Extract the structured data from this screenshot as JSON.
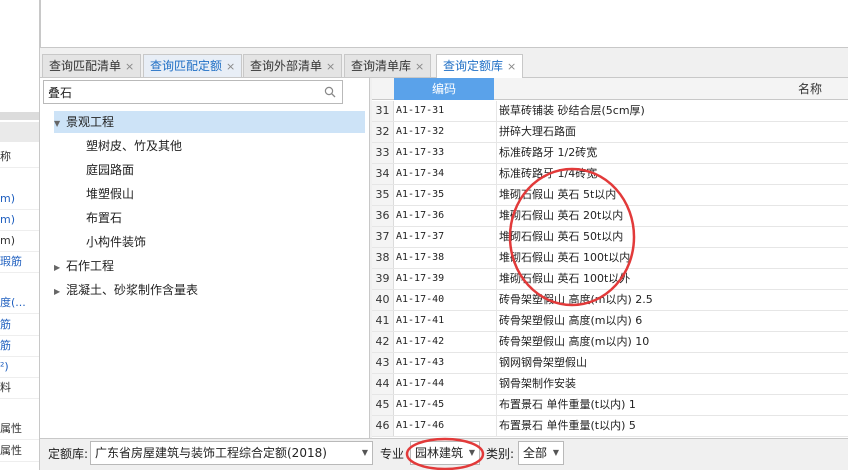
{
  "left_panel": {
    "items": [
      {
        "text": "称",
        "style": "dark"
      },
      {
        "text": "m)",
        "style": "blue"
      },
      {
        "text": "m)",
        "style": "blue"
      },
      {
        "text": "m)",
        "style": "dark"
      },
      {
        "text": "瑕筋",
        "style": "blue"
      },
      {
        "text": "",
        "style": "dark"
      },
      {
        "text": "度(...",
        "style": "blue"
      },
      {
        "text": "筋",
        "style": "blue"
      },
      {
        "text": "筋",
        "style": "blue"
      },
      {
        "text": "²)",
        "style": "blue"
      },
      {
        "text": "料",
        "style": "dark"
      },
      {
        "text": "",
        "style": "dark"
      },
      {
        "text": "属性",
        "style": "dark"
      },
      {
        "text": "属性",
        "style": "dark"
      }
    ]
  },
  "tabs": [
    {
      "label": "查询匹配清单",
      "close": "×"
    },
    {
      "label": "查询匹配定额",
      "close": "×"
    },
    {
      "label": "查询外部清单",
      "close": "×"
    },
    {
      "label": "查询清单库",
      "close": "×"
    },
    {
      "label": "查询定额库",
      "close": "×"
    }
  ],
  "search": {
    "value": "叠石",
    "icon": "search-icon"
  },
  "tree": [
    {
      "label": "景观工程",
      "level": 0,
      "expanded": true,
      "selected": true
    },
    {
      "label": "塑树皮、竹及其他",
      "level": 1
    },
    {
      "label": "庭园路面",
      "level": 1
    },
    {
      "label": "堆塑假山",
      "level": 1
    },
    {
      "label": "布置石",
      "level": 1
    },
    {
      "label": "小构件装饰",
      "level": 1
    },
    {
      "label": "石作工程",
      "level": 0,
      "expanded": false
    },
    {
      "label": "混凝土、砂浆制作含量表",
      "level": 0,
      "expanded": false
    }
  ],
  "grid": {
    "header_code": "编码",
    "header_name": "名称",
    "rows": [
      {
        "num": "31",
        "code": "A1-17-31",
        "name": "嵌草砖铺装 砂结合层(5cm厚)"
      },
      {
        "num": "32",
        "code": "A1-17-32",
        "name": "拼碎大理石路面"
      },
      {
        "num": "33",
        "code": "A1-17-33",
        "name": "标准砖路牙 1/2砖宽"
      },
      {
        "num": "34",
        "code": "A1-17-34",
        "name": "标准砖路牙 1/4砖宽"
      },
      {
        "num": "35",
        "code": "A1-17-35",
        "name": "堆砌石假山 英石 5t以内"
      },
      {
        "num": "36",
        "code": "A1-17-36",
        "name": "堆砌石假山 英石 20t以内"
      },
      {
        "num": "37",
        "code": "A1-17-37",
        "name": "堆砌石假山 英石 50t以内"
      },
      {
        "num": "38",
        "code": "A1-17-38",
        "name": "堆砌石假山 英石 100t以内"
      },
      {
        "num": "39",
        "code": "A1-17-39",
        "name": "堆砌石假山 英石 100t以外"
      },
      {
        "num": "40",
        "code": "A1-17-40",
        "name": "砖骨架塑假山 高度(m以内) 2.5"
      },
      {
        "num": "41",
        "code": "A1-17-41",
        "name": "砖骨架塑假山 高度(m以内) 6"
      },
      {
        "num": "42",
        "code": "A1-17-42",
        "name": "砖骨架塑假山 高度(m以内) 10"
      },
      {
        "num": "43",
        "code": "A1-17-43",
        "name": "钢网钢骨架塑假山"
      },
      {
        "num": "44",
        "code": "A1-17-44",
        "name": "钢骨架制作安装"
      },
      {
        "num": "45",
        "code": "A1-17-45",
        "name": "布置景石 单件重量(t以内) 1"
      },
      {
        "num": "46",
        "code": "A1-17-46",
        "name": "布置景石 单件重量(t以内) 5"
      }
    ]
  },
  "bottom": {
    "quota_label": "定额库:",
    "quota_value": "广东省房屋建筑与装饰工程综合定额(2018)",
    "specialty_label": "专业",
    "specialty_value": "园林建筑",
    "category_label": "类别:",
    "category_value": "全部"
  },
  "colors": {
    "accent": "#5aa2ea",
    "highlight": "#cde3f7",
    "annotation": "#e23a3a"
  }
}
